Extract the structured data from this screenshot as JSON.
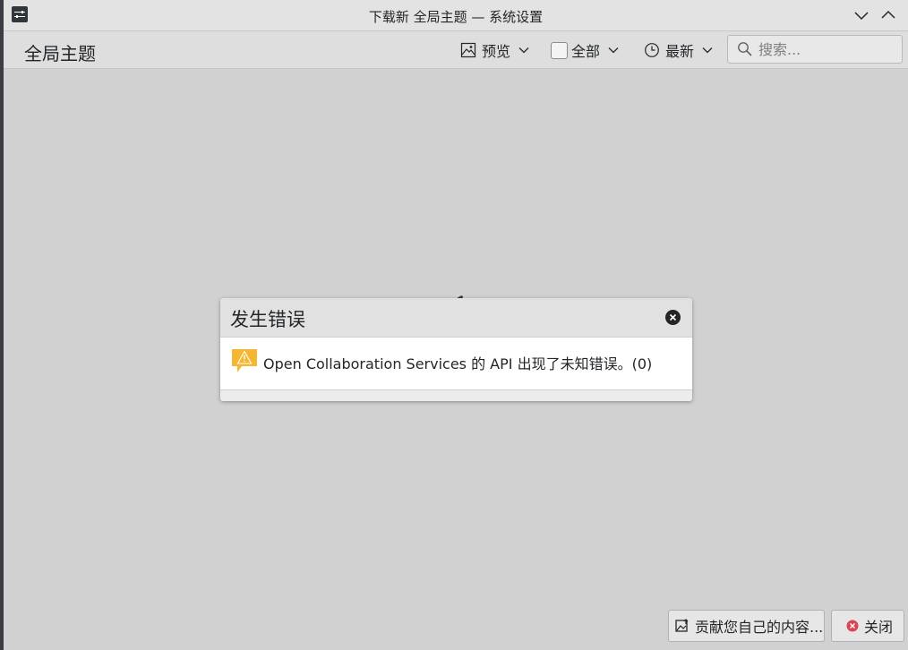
{
  "window": {
    "title": "下载新 全局主题 — 系统设置",
    "icons": {
      "app": "settings-sliders-icon",
      "minimize": "chevron-down-icon",
      "maximize": "chevron-up-icon"
    }
  },
  "toolbar": {
    "page_title": "全局主题",
    "view_mode": {
      "label": "预览",
      "icon": "image-icon"
    },
    "filter": {
      "label": "全部",
      "checked": false
    },
    "sort": {
      "label": "最新",
      "icon": "clock-icon"
    },
    "search": {
      "placeholder": "搜索...",
      "value": ""
    }
  },
  "dialog": {
    "title": "发生错误",
    "message": "Open Collaboration Services 的 API 出现了未知错误。(0)",
    "icon": "warning-icon"
  },
  "footer": {
    "contribute_label": "贡献您自己的内容...",
    "close_label": "关闭"
  },
  "colors": {
    "background": "#d1d1d1",
    "titlebar": "#e3e3e3",
    "warning": "#f5b731",
    "close_red": "#da4453"
  }
}
